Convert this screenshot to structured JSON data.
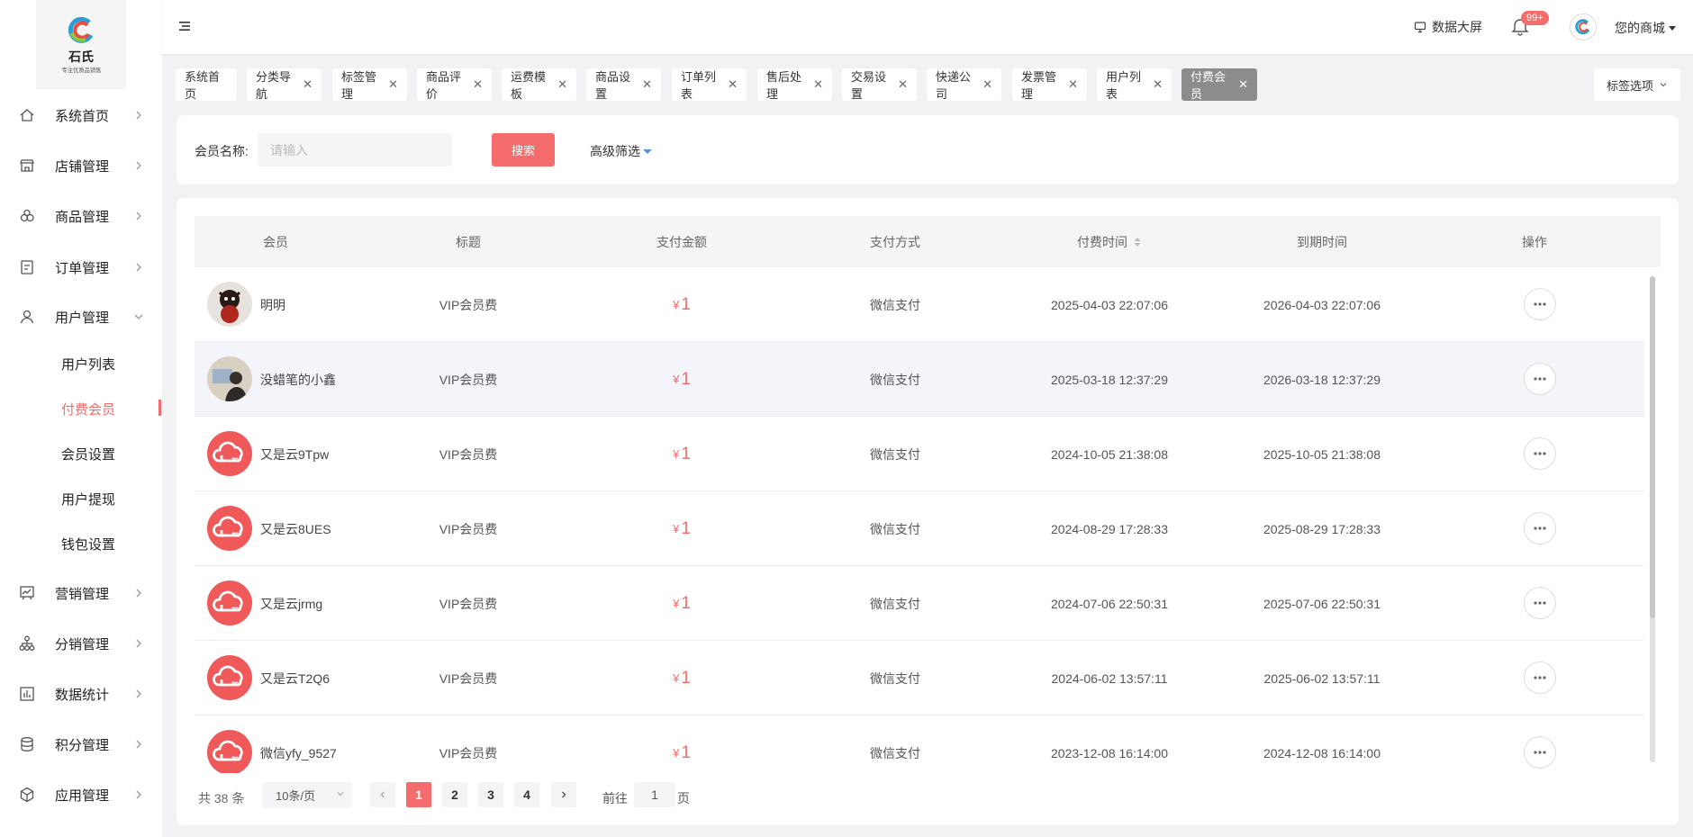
{
  "logo": {
    "name": "石氏",
    "sub": "专注优质品销售"
  },
  "sidebar": {
    "items": [
      {
        "label": "系统首页",
        "icon": "home-icon"
      },
      {
        "label": "店铺管理",
        "icon": "store-icon"
      },
      {
        "label": "商品管理",
        "icon": "goods-icon"
      },
      {
        "label": "订单管理",
        "icon": "order-icon"
      },
      {
        "label": "用户管理",
        "icon": "user-icon",
        "expanded": true
      },
      {
        "label": "营销管理",
        "icon": "marketing-icon"
      },
      {
        "label": "分销管理",
        "icon": "distribution-icon"
      },
      {
        "label": "数据统计",
        "icon": "stats-icon"
      },
      {
        "label": "积分管理",
        "icon": "points-icon"
      },
      {
        "label": "应用管理",
        "icon": "app-icon"
      }
    ],
    "sub_items": [
      {
        "label": "用户列表"
      },
      {
        "label": "付费会员",
        "active": true
      },
      {
        "label": "会员设置"
      },
      {
        "label": "用户提现"
      },
      {
        "label": "钱包设置"
      }
    ]
  },
  "topbar": {
    "screen_label": "数据大屏",
    "badge": "99+",
    "shop_name": "您的商城"
  },
  "tags": [
    {
      "label": "系统首页",
      "closable": false
    },
    {
      "label": "分类导航",
      "closable": true
    },
    {
      "label": "标签管理",
      "closable": true
    },
    {
      "label": "商品评价",
      "closable": true
    },
    {
      "label": "运费模板",
      "closable": true
    },
    {
      "label": "商品设置",
      "closable": true
    },
    {
      "label": "订单列表",
      "closable": true
    },
    {
      "label": "售后处理",
      "closable": true
    },
    {
      "label": "交易设置",
      "closable": true
    },
    {
      "label": "快递公司",
      "closable": true
    },
    {
      "label": "发票管理",
      "closable": true
    },
    {
      "label": "用户列表",
      "closable": true
    },
    {
      "label": "付费会员",
      "closable": true,
      "active": true
    }
  ],
  "tag_options_label": "标签选项",
  "filter": {
    "label": "会员名称:",
    "placeholder": "请输入",
    "search_label": "搜索",
    "advanced_label": "高级筛选"
  },
  "table": {
    "headers": [
      "会员",
      "标题",
      "支付金额",
      "支付方式",
      "付费时间",
      "到期时间",
      "操作"
    ],
    "currency": "¥",
    "rows": [
      {
        "member": "明明",
        "avatar": "doll",
        "title": "VIP会员费",
        "amount": "1",
        "method": "微信支付",
        "paid_at": "2025-04-03 22:07:06",
        "expires_at": "2026-04-03 22:07:06"
      },
      {
        "member": "没蜡笔的小鑫",
        "avatar": "photo",
        "title": "VIP会员费",
        "amount": "1",
        "method": "微信支付",
        "paid_at": "2025-03-18 12:37:29",
        "expires_at": "2026-03-18 12:37:29",
        "highlight": true
      },
      {
        "member": "又是云9Tpw",
        "avatar": "cloud",
        "title": "VIP会员费",
        "amount": "1",
        "method": "微信支付",
        "paid_at": "2024-10-05 21:38:08",
        "expires_at": "2025-10-05 21:38:08"
      },
      {
        "member": "又是云8UES",
        "avatar": "cloud",
        "title": "VIP会员费",
        "amount": "1",
        "method": "微信支付",
        "paid_at": "2024-08-29 17:28:33",
        "expires_at": "2025-08-29 17:28:33"
      },
      {
        "member": "又是云jrmg",
        "avatar": "cloud",
        "title": "VIP会员费",
        "amount": "1",
        "method": "微信支付",
        "paid_at": "2024-07-06 22:50:31",
        "expires_at": "2025-07-06 22:50:31"
      },
      {
        "member": "又是云T2Q6",
        "avatar": "cloud",
        "title": "VIP会员费",
        "amount": "1",
        "method": "微信支付",
        "paid_at": "2024-06-02 13:57:11",
        "expires_at": "2025-06-02 13:57:11"
      },
      {
        "member": "微信yfy_9527",
        "avatar": "cloud",
        "title": "VIP会员费",
        "amount": "1",
        "method": "微信支付",
        "paid_at": "2023-12-08 16:14:00",
        "expires_at": "2024-12-08 16:14:00"
      }
    ]
  },
  "pagination": {
    "total": "共 38 条",
    "page_size": "10条/页",
    "pages": [
      "1",
      "2",
      "3",
      "4"
    ],
    "current": "1",
    "goto_label": "前往",
    "goto_value": "1",
    "page_label": "页"
  },
  "colors": {
    "accent": "#f56c6c",
    "active_tag": "#8c8c8c"
  }
}
